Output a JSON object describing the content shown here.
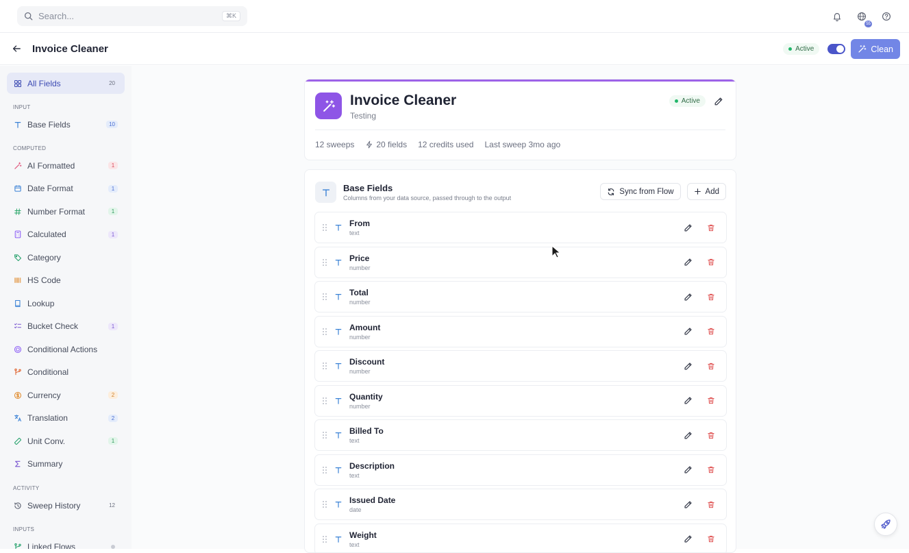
{
  "topbar": {
    "search_placeholder": "Search...",
    "search_shortcut": "⌘K",
    "notification_badge": "55"
  },
  "header": {
    "title": "Invoice Cleaner",
    "status": "Active",
    "clean_label": "Clean"
  },
  "sidebar": {
    "all_fields": {
      "label": "All Fields",
      "count": "20"
    },
    "group_input": "INPUT",
    "base_fields": {
      "label": "Base Fields",
      "count": "10"
    },
    "group_computed": "COMPUTED",
    "computed": [
      {
        "label": "AI Formatted",
        "count": "1",
        "icon": "wand-icon",
        "color": "#e0527a"
      },
      {
        "label": "Date Format",
        "count": "1",
        "icon": "calendar-icon",
        "color": "#3b82d6"
      },
      {
        "label": "Number Format",
        "count": "1",
        "icon": "hash-icon",
        "color": "#2aa66a"
      },
      {
        "label": "Calculated",
        "count": "1",
        "icon": "calculator-icon",
        "color": "#8b5cf6"
      },
      {
        "label": "Category",
        "count": "",
        "icon": "tag-icon",
        "color": "#23a06a"
      },
      {
        "label": "HS Code",
        "count": "",
        "icon": "barcode-icon",
        "color": "#e08a2c"
      },
      {
        "label": "Lookup",
        "count": "",
        "icon": "book-icon",
        "color": "#3b82d6"
      },
      {
        "label": "Bucket Check",
        "count": "1",
        "icon": "checklist-icon",
        "color": "#7a57d1"
      },
      {
        "label": "Conditional Actions",
        "count": "",
        "icon": "target-icon",
        "color": "#8b5cf6"
      },
      {
        "label": "Conditional",
        "count": "",
        "icon": "branch-icon",
        "color": "#e0622c"
      },
      {
        "label": "Currency",
        "count": "2",
        "icon": "coin-icon",
        "color": "#e08a2c"
      },
      {
        "label": "Translation",
        "count": "2",
        "icon": "translate-icon",
        "color": "#3b82d6"
      },
      {
        "label": "Unit Conv.",
        "count": "1",
        "icon": "ruler-icon",
        "color": "#23a06a"
      },
      {
        "label": "Summary",
        "count": "",
        "icon": "sigma-icon",
        "color": "#7a57d1"
      }
    ],
    "group_activity": "ACTIVITY",
    "sweep_history": {
      "label": "Sweep History",
      "count": "12"
    },
    "group_inputs": "INPUTS",
    "linked_flows": {
      "label": "Linked Flows"
    }
  },
  "overview": {
    "title": "Invoice Cleaner",
    "subtitle": "Testing",
    "status": "Active",
    "stats": {
      "sweeps": "12 sweeps",
      "fields": "20 fields",
      "credits": "12 credits used",
      "last_sweep": "Last sweep 3mo ago"
    }
  },
  "base_fields": {
    "title": "Base Fields",
    "subtitle": "Columns from your data source, passed through to the output",
    "sync_label": "Sync from Flow",
    "add_label": "Add",
    "fields": [
      {
        "name": "From",
        "type": "text"
      },
      {
        "name": "Price",
        "type": "number"
      },
      {
        "name": "Total",
        "type": "number"
      },
      {
        "name": "Amount",
        "type": "number"
      },
      {
        "name": "Discount",
        "type": "number"
      },
      {
        "name": "Quantity",
        "type": "number"
      },
      {
        "name": "Billed To",
        "type": "text"
      },
      {
        "name": "Description",
        "type": "text"
      },
      {
        "name": "Issued Date",
        "type": "date"
      },
      {
        "name": "Weight",
        "type": "text"
      }
    ]
  },
  "colors": {
    "accent": "#7286e6",
    "brand_purple": "#8e55e6",
    "active_green": "#22b66a",
    "delete_red": "#e05656"
  }
}
